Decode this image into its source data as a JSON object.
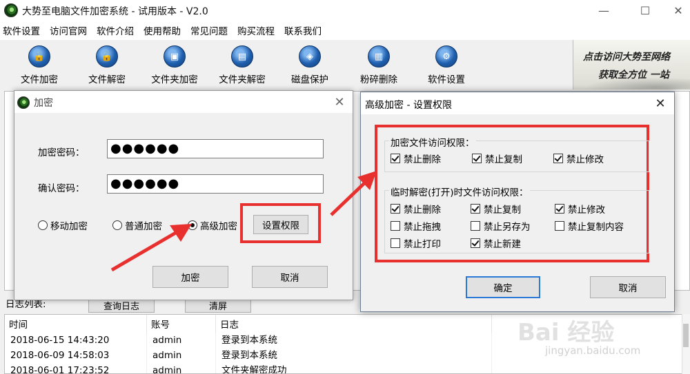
{
  "window": {
    "title": "大势至电脑文件加密系统 - 试用版本 - V2.0",
    "minimize_glyph": "—",
    "maximize_glyph": "☐",
    "close_glyph": "✕"
  },
  "menu": {
    "items": [
      "软件设置",
      "访问官网",
      "软件介绍",
      "使用帮助",
      "常见问题",
      "购买流程",
      "联系我们"
    ]
  },
  "toolbar": {
    "tools": [
      {
        "label": "文件加密",
        "icon": "file-lock-icon"
      },
      {
        "label": "文件解密",
        "icon": "file-unlock-icon"
      },
      {
        "label": "文件夹加密",
        "icon": "folder-lock-icon"
      },
      {
        "label": "文件夹解密",
        "icon": "folder-unlock-icon"
      },
      {
        "label": "磁盘保护",
        "icon": "disk-shield-icon"
      },
      {
        "label": "粉碎删除",
        "icon": "shred-icon"
      },
      {
        "label": "软件设置",
        "icon": "gear-icon"
      }
    ]
  },
  "banner": {
    "line1": "点击访问大势至网络",
    "line2": "获取全方位 一站"
  },
  "log": {
    "label": "日志列表:",
    "query_button": "查询日志",
    "clear_button": "清屏",
    "columns": [
      "时间",
      "账号",
      "日志"
    ],
    "rows": [
      {
        "time": "2018-06-15 14:43:20",
        "account": "admin",
        "log": "登录到本系统"
      },
      {
        "time": "2018-06-09 14:58:03",
        "account": "admin",
        "log": "登录到本系统"
      },
      {
        "time": "2018-06-01 17:23:52",
        "account": "admin",
        "log": "文件夹解密成功"
      }
    ]
  },
  "encrypt_dialog": {
    "title": "加密",
    "password_label": "加密密码：",
    "password_value": "●●●●●●",
    "confirm_label": "确认密码：",
    "confirm_value": "●●●●●●",
    "modes": [
      {
        "label": "移动加密",
        "checked": false
      },
      {
        "label": "普通加密",
        "checked": false
      },
      {
        "label": "高级加密",
        "checked": true
      }
    ],
    "permissions_button": "设置权限",
    "encrypt_button": "加密",
    "cancel_button": "取消"
  },
  "advanced_dialog": {
    "title": "高级加密 - 设置权限",
    "group1_title": "加密文件访问权限：",
    "group1_items": [
      {
        "label": "禁止删除",
        "checked": true
      },
      {
        "label": "禁止复制",
        "checked": true
      },
      {
        "label": "禁止修改",
        "checked": true
      }
    ],
    "group2_title": "临时解密(打开)时文件访问权限：",
    "group2_items": [
      {
        "label": "禁止删除",
        "checked": true
      },
      {
        "label": "禁止复制",
        "checked": true
      },
      {
        "label": "禁止修改",
        "checked": true
      },
      {
        "label": "禁止拖拽",
        "checked": false
      },
      {
        "label": "禁止另存为",
        "checked": false
      },
      {
        "label": "禁止复制内容",
        "checked": false
      },
      {
        "label": "禁止打印",
        "checked": false
      },
      {
        "label": "禁止新建",
        "checked": true
      }
    ],
    "ok_button": "确定",
    "cancel_button": "取消"
  },
  "watermark": {
    "text": "Bai 经验",
    "sub": "jingyan.baidu.com"
  },
  "colors": {
    "highlight": "#e8302f",
    "arrow": "#e8302f"
  }
}
